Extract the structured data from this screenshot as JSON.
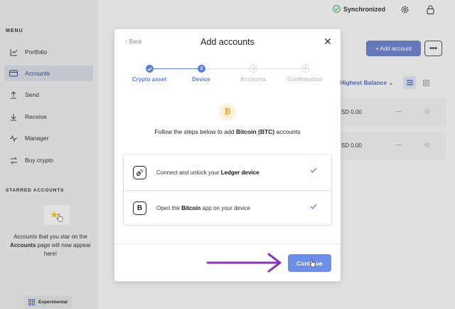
{
  "window": {
    "traffic_colors": [
      "#ff5f57",
      "#febc2e",
      "#28c840"
    ]
  },
  "topbar": {
    "sync_status": "Synchronized"
  },
  "sidebar": {
    "menu_label": "MENU",
    "items": [
      {
        "label": "Portfolio",
        "icon": "chart-icon"
      },
      {
        "label": "Accounts",
        "icon": "wallet-icon",
        "active": true
      },
      {
        "label": "Send",
        "icon": "send-icon"
      },
      {
        "label": "Receive",
        "icon": "receive-icon"
      },
      {
        "label": "Manager",
        "icon": "manager-icon"
      },
      {
        "label": "Buy crypto",
        "icon": "swap-icon"
      }
    ],
    "starred_label": "STARRED ACCOUNTS",
    "starred_text_pre": "Accounts that you star on the",
    "starred_text_bold": "Accounts",
    "starred_text_post": "page will now appear here!",
    "experimental_label": "Experimental"
  },
  "main": {
    "add_account_label": "+ Add account",
    "more_label": "•••",
    "sort_label": "Highest Balance",
    "rows": [
      {
        "value": "SD 0.00",
        "change": "—"
      },
      {
        "value": "SD 0.00",
        "change": "—"
      }
    ]
  },
  "modal": {
    "back_label": "Back",
    "title": "Add accounts",
    "steps": [
      {
        "label": "Crypto asset",
        "index": "1",
        "state": "done"
      },
      {
        "label": "Device",
        "index": "2",
        "state": "active"
      },
      {
        "label": "Accounts",
        "index": "3",
        "state": "pending"
      },
      {
        "label": "Confirmation",
        "index": "4",
        "state": "pending"
      }
    ],
    "coin_symbol": "₿",
    "instruction_pre": "Follow the steps below to add",
    "instruction_bold": "Bitcoin (BTC)",
    "instruction_post": "accounts",
    "step_rows": [
      {
        "pre": "Connect and unlock your",
        "bold": "Ledger device",
        "post": ""
      },
      {
        "pre": "Open the",
        "bold": "Bitcoin",
        "post": "app on your device"
      }
    ],
    "continue_label": "Continue"
  },
  "colors": {
    "accent": "#5269b8",
    "button": "#6b8fe8",
    "arrow": "#8a35b5",
    "btc": "#f3a12a"
  }
}
